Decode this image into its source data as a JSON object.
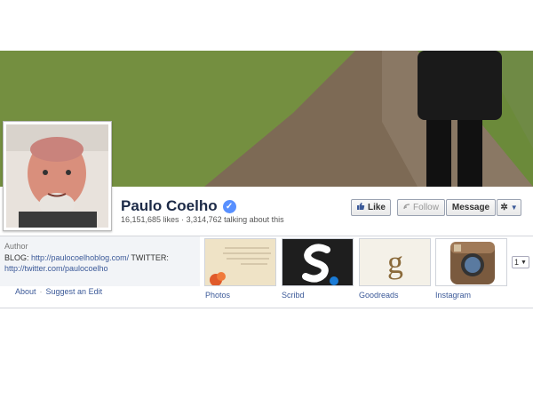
{
  "profile": {
    "name": "Paulo Coelho",
    "verified_mark": "✓",
    "likes_text": "16,151,685 likes",
    "separator": "·",
    "talking_text": "3,314,762 talking about this"
  },
  "actions": {
    "like_label": "Like",
    "like_icon": "thumbs-up-icon",
    "follow_label": "Follow",
    "message_label": "Message",
    "gear_icon": "gear-icon"
  },
  "about": {
    "category": "Author",
    "blog_prefix": "BLOG: ",
    "blog_url": "http://paulocoelhoblog.com/",
    "twitter_prefix": " TWITTER: ",
    "twitter_url": "http://twitter.com/paulocoelho",
    "about_link": "About",
    "sep": "·",
    "suggest_link": "Suggest an Edit"
  },
  "apps": [
    {
      "label": "Photos",
      "icon": "photos-thumbnail"
    },
    {
      "label": "Scribd",
      "icon": "scribd-icon"
    },
    {
      "label": "Goodreads",
      "icon": "goodreads-icon"
    },
    {
      "label": "Instagram",
      "icon": "instagram-icon"
    }
  ],
  "pager": {
    "count": "1",
    "icon": "chevron-down-icon"
  },
  "colors": {
    "link": "#3b5998",
    "name": "#1c2a47",
    "verified": "#5890ff"
  }
}
